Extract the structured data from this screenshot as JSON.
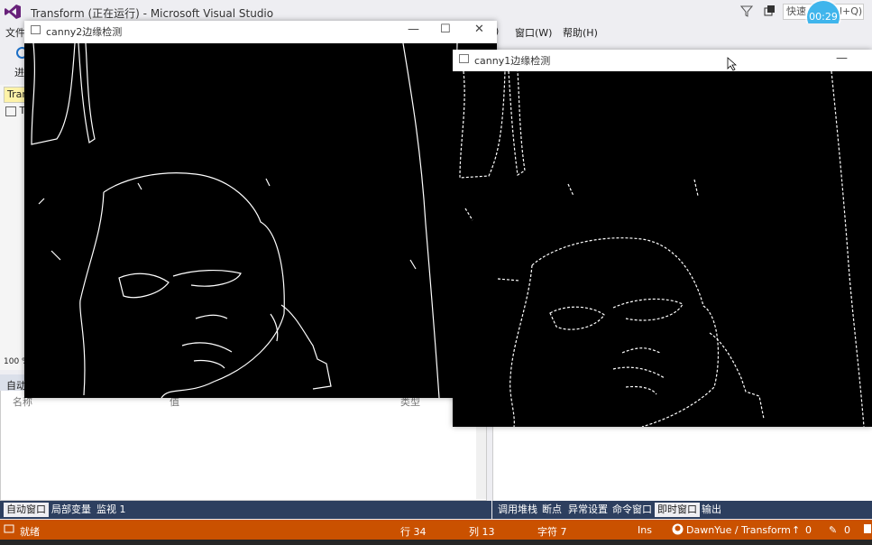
{
  "vs": {
    "title": "Transform (正在运行) - Microsoft Visual Studio",
    "menu": {
      "file": "文件",
      "window": "窗口(W)",
      "help": "帮助(H)",
      "partial": ")"
    },
    "quick_launch": "快速",
    "quick_launch_suffix": "l+Q)",
    "timer": "00:29",
    "left_tab": "Tran",
    "left_tab2": "T",
    "left_label": "进",
    "zoom": "100 %"
  },
  "canny2": {
    "title": "canny2边缘检测",
    "min": "—",
    "max": "☐",
    "close": "✕"
  },
  "canny1": {
    "title": "canny1边缘检测",
    "min": "—"
  },
  "autos": {
    "title": "自动窗口",
    "columns": [
      "名称",
      "值",
      "类型"
    ]
  },
  "bottom_tabs_left": [
    "自动窗口",
    "局部变量",
    "监视 1"
  ],
  "bottom_tabs_right": [
    "调用堆栈",
    "断点",
    "异常设置",
    "命令窗口",
    "即时窗口",
    "输出"
  ],
  "status": {
    "ready": "就绪",
    "line": "行 34",
    "col": "列 13",
    "char": "字符 7",
    "ins": "Ins",
    "repo": "DawnYue / Transform",
    "up": "0",
    "edits": "0"
  }
}
